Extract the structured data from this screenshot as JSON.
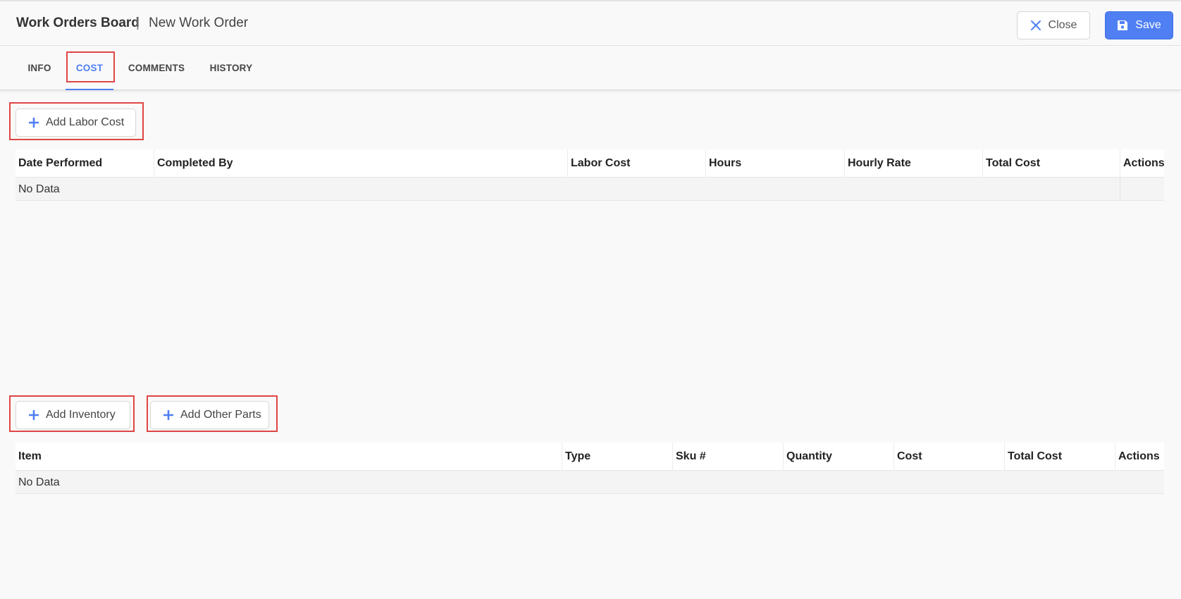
{
  "header": {
    "board": "Work Orders Board",
    "separator": "|",
    "current": "New Work Order",
    "close_label": "Close",
    "save_label": "Save"
  },
  "tabs": [
    {
      "label": "INFO",
      "active": false
    },
    {
      "label": "COST",
      "active": true
    },
    {
      "label": "COMMENTS",
      "active": false
    },
    {
      "label": "HISTORY",
      "active": false
    }
  ],
  "labor": {
    "add_label": "Add Labor Cost",
    "columns": [
      "Date Performed",
      "Completed By",
      "Labor Cost",
      "Hours",
      "Hourly Rate",
      "Total Cost",
      "Actions"
    ],
    "empty_text": "No Data"
  },
  "parts": {
    "add_inventory_label": "Add Inventory",
    "add_other_label": "Add Other Parts",
    "columns": [
      "Item",
      "Type",
      "Sku #",
      "Quantity",
      "Cost",
      "Total Cost",
      "Actions"
    ],
    "empty_text": "No Data"
  },
  "colors": {
    "accent": "#4f7ff3",
    "highlight": "#e04545"
  }
}
